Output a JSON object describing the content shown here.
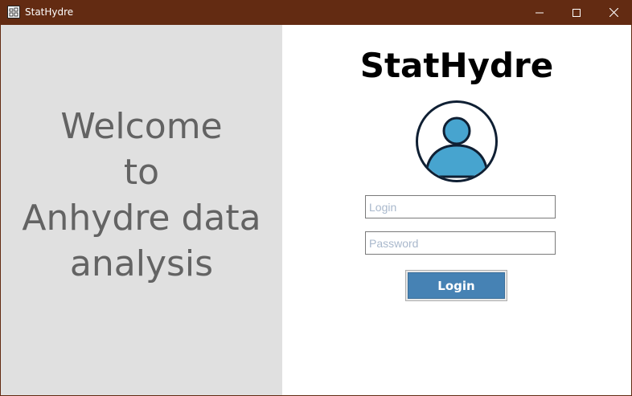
{
  "window": {
    "title": "StatHydre",
    "controls": {
      "minimize_icon": "minimize-icon",
      "maximize_icon": "maximize-icon",
      "close_icon": "close-icon"
    },
    "titlebar_color": "#632b12"
  },
  "welcome_panel": {
    "lines": [
      "Welcome",
      "to",
      "Anhydre data",
      "analysis"
    ],
    "background": "#e0e0e0",
    "text_color": "#636363"
  },
  "login_panel": {
    "brand": "StatHydre",
    "avatar_icon": "user-avatar-icon",
    "login_field": {
      "placeholder": "Login",
      "value": ""
    },
    "password_field": {
      "placeholder": "Password",
      "value": ""
    },
    "login_button_label": "Login",
    "button_color": "#4682b4"
  }
}
